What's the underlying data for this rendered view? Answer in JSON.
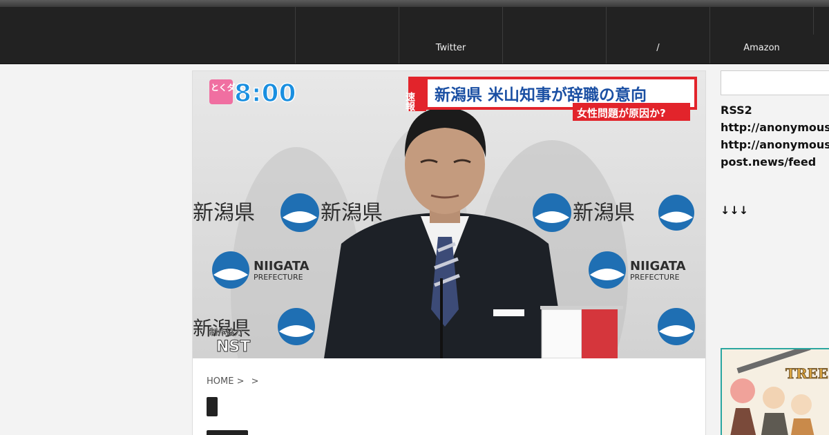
{
  "header": {
    "nav": [
      {
        "label": ""
      },
      {
        "label": "Twitter"
      },
      {
        "label": ""
      },
      {
        "label": "/"
      },
      {
        "label": "Amazon"
      },
      {
        "label": ""
      }
    ]
  },
  "hero": {
    "program_logo_kana": "とくダネ",
    "program_time": "8:00",
    "flash_label": "速報",
    "headline": "新潟県 米山知事が辞職の意向",
    "subheadline": "女性問題が原因か?",
    "backdrop_text_jp": "新潟県",
    "backdrop_text_en_1": "NIIGATA",
    "backdrop_text_en_2": "PREFECTURE",
    "credit_label": "制作協力",
    "credit_name": "NST"
  },
  "breadcrumb": {
    "home": "HOME >",
    "sep": ">"
  },
  "sidebar": {
    "search_placeholder": "",
    "rss_lines": [
      "RSS2",
      "http://anonymous-",
      "http://anonymous-",
      "post.news/feed"
    ],
    "arrows": "↓↓↓",
    "banner_text": "TREE OF SAVIOR"
  },
  "colors": {
    "header_bg": "#222222",
    "page_bg": "#f3f3f3",
    "headline_red": "#e2242b",
    "accent_teal": "#2aa6a0"
  }
}
